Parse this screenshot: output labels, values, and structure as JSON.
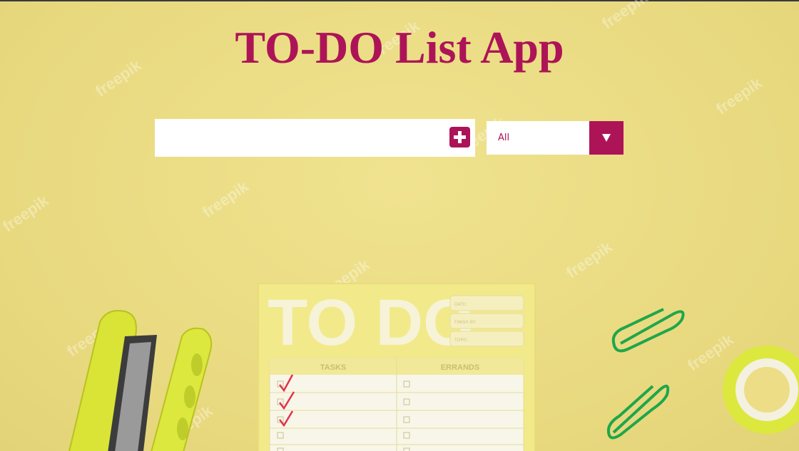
{
  "app": {
    "title": "TO-DO List App"
  },
  "todo_input": {
    "value": "",
    "placeholder": ""
  },
  "filter_select": {
    "selected": "All"
  },
  "background": {
    "notepad_title": "TO DO",
    "field_labels": [
      "DATE:",
      "FINISH BY:",
      "TOPIC:"
    ],
    "columns": [
      "TASKS",
      "ERRANDS"
    ],
    "watermark": "freepik"
  },
  "colors": {
    "accent": "#ad1457",
    "background": "#ecdd86",
    "panel": "#ffffff"
  },
  "icons": {
    "add": "plus-icon",
    "dropdown": "chevron-down-icon"
  }
}
